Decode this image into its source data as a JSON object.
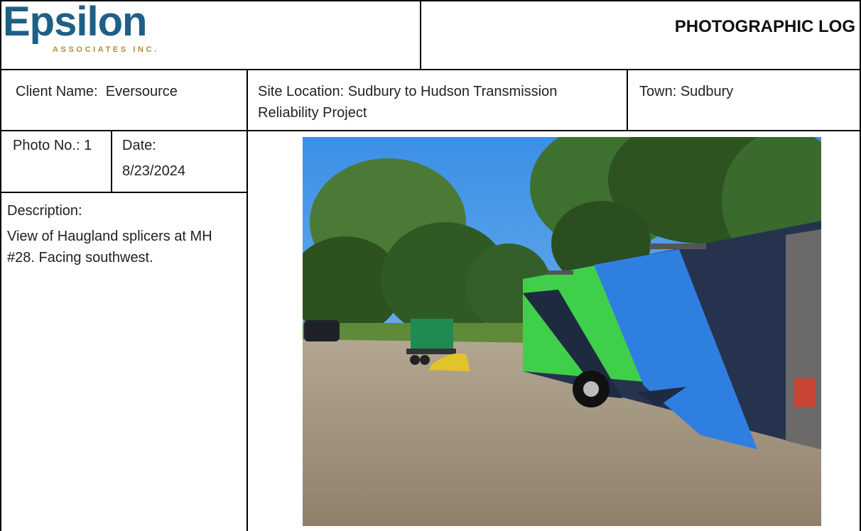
{
  "header": {
    "logo_text": "Epsilon",
    "logo_subtext": "ASSOCIATES INC.",
    "title": "PHOTOGRAPHIC LOG"
  },
  "info": {
    "client_label": "Client Name:",
    "client_value": "Eversource",
    "site_line1": "Site Location: Sudbury to Hudson Transmission",
    "site_line2": "Reliability Project",
    "town_label": "Town:",
    "town_value": "Sudbury"
  },
  "photo": {
    "number_label": "Photo No.:",
    "number_value": "1",
    "date_label": "Date:",
    "date_value": "8/23/2024",
    "description_label": "Description:",
    "description_line1": "View of Haugland splicers at MH",
    "description_line2": "#28. Facing southwest."
  },
  "colors": {
    "brand_blue": "#1f5f86",
    "brand_gold": "#b38a3a",
    "trailer_green": "#3fcf4a",
    "trailer_blue": "#2f7fe0",
    "trailer_navy": "#25334f"
  }
}
